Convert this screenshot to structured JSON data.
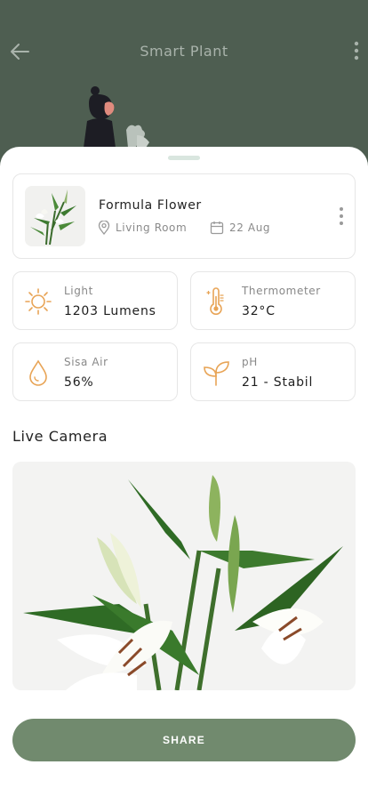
{
  "header": {
    "title": "Smart Plant",
    "back_icon": "arrow-left-icon",
    "menu_icon": "more-vertical-icon",
    "background": "#4e5e51"
  },
  "plant": {
    "name": "Formula Flower",
    "location": "Living Room",
    "date": "22 Aug",
    "location_icon": "map-pin-icon",
    "date_icon": "calendar-icon"
  },
  "stats": [
    {
      "label": "Light",
      "value": "1203 Lumens",
      "icon": "sun-icon"
    },
    {
      "label": "Thermometer",
      "value": "32°C",
      "icon": "thermometer-icon"
    },
    {
      "label": "Sisa Air",
      "value": "56%",
      "icon": "water-drop-icon"
    },
    {
      "label": "pH",
      "value": "21 - Stabil",
      "icon": "sprout-icon"
    }
  ],
  "camera": {
    "title": "Live Camera"
  },
  "share": {
    "label": "SHARE"
  },
  "colors": {
    "accent": "#718a6e",
    "icon": "#e8a456",
    "header": "#4e5e51"
  }
}
